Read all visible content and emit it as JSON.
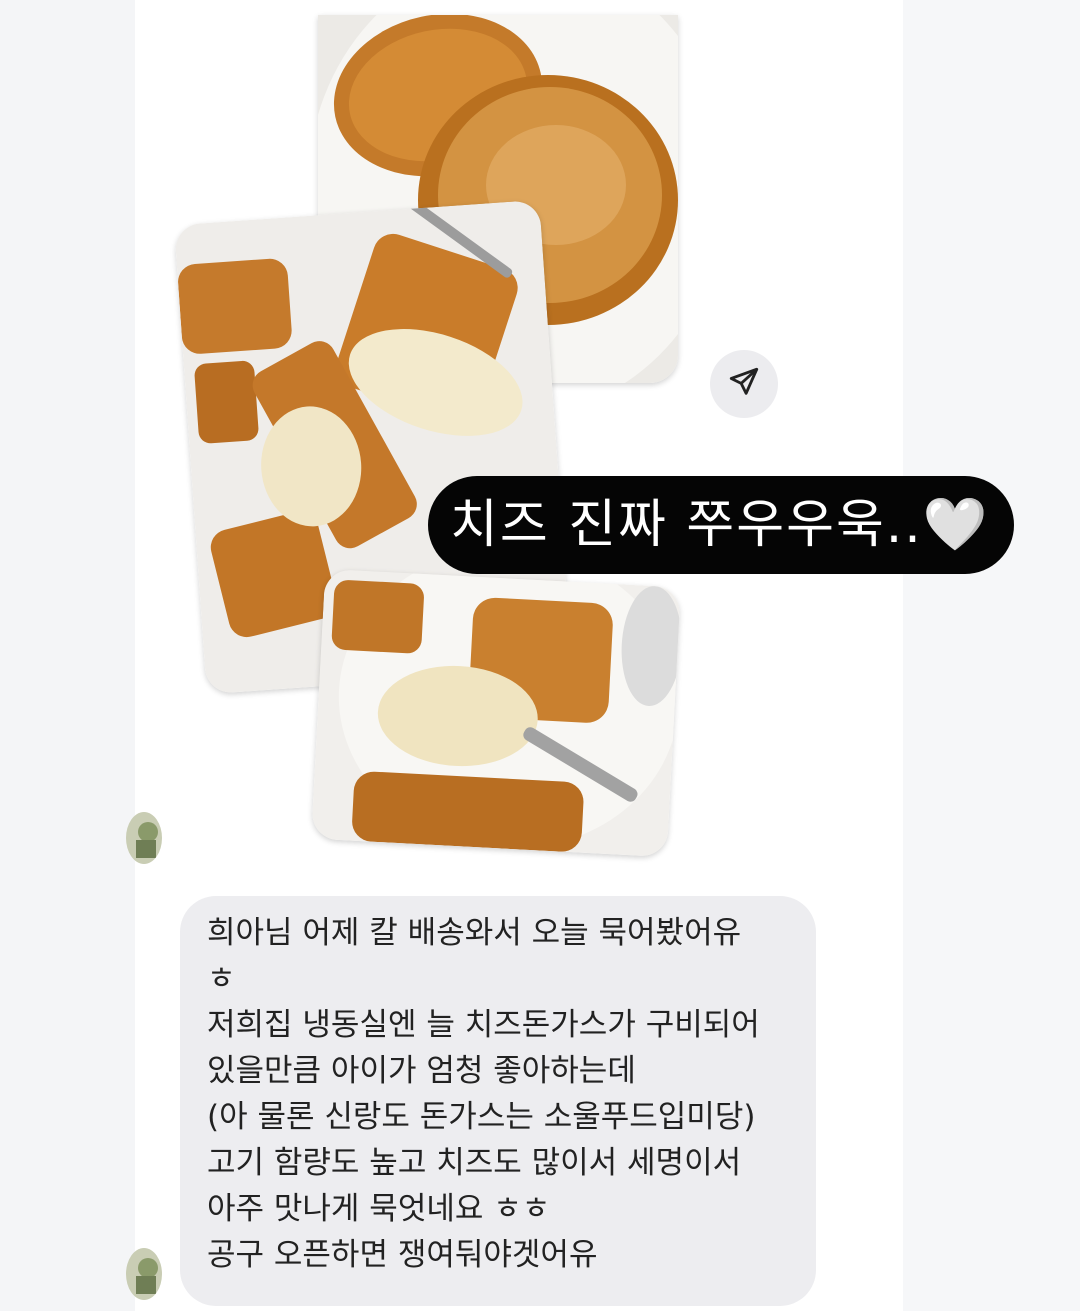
{
  "sticker": {
    "text": "치즈 진짜 쭈우우욱..🤍"
  },
  "message": {
    "lines": [
      "희아님 어제 칼 배송와서 오늘 묵어봤어유",
      "ㅎ",
      "저희집 냉동실엔 늘 치즈돈가스가 구비되어",
      "있을만큼 아이가 엄청 좋아하는데",
      "(아 물론 신랑도 돈가스는 소울푸드입미당)",
      "고기 함량도 높고 치즈도 많이서 세명이서",
      "아주 맛나게 묵엇네요 ㅎㅎ",
      "공구 오픈하면 쟁여둬야겟어유"
    ]
  },
  "icons": {
    "share": "paper-plane-icon",
    "avatar": "profile-avatar"
  },
  "colors": {
    "sticker_bg": "#050505",
    "bubble_bg": "#ededf0",
    "panel_bg": "#ffffff"
  }
}
